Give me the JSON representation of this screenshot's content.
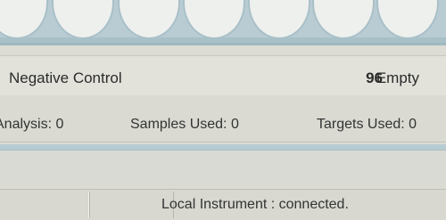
{
  "legend": {
    "label": "Negative Control",
    "count": "96",
    "status": "Empty"
  },
  "stats": {
    "analysis": "Analysis: 0",
    "samples_used": "Samples Used: 0",
    "targets_used": "Targets Used: 0"
  },
  "status_bar": {
    "instrument": "Local Instrument : connected."
  },
  "colors": {
    "well_fill": "#eef0ee",
    "plate_blue": "#b9ccd3",
    "panel_bg": "#dcdcd5"
  }
}
